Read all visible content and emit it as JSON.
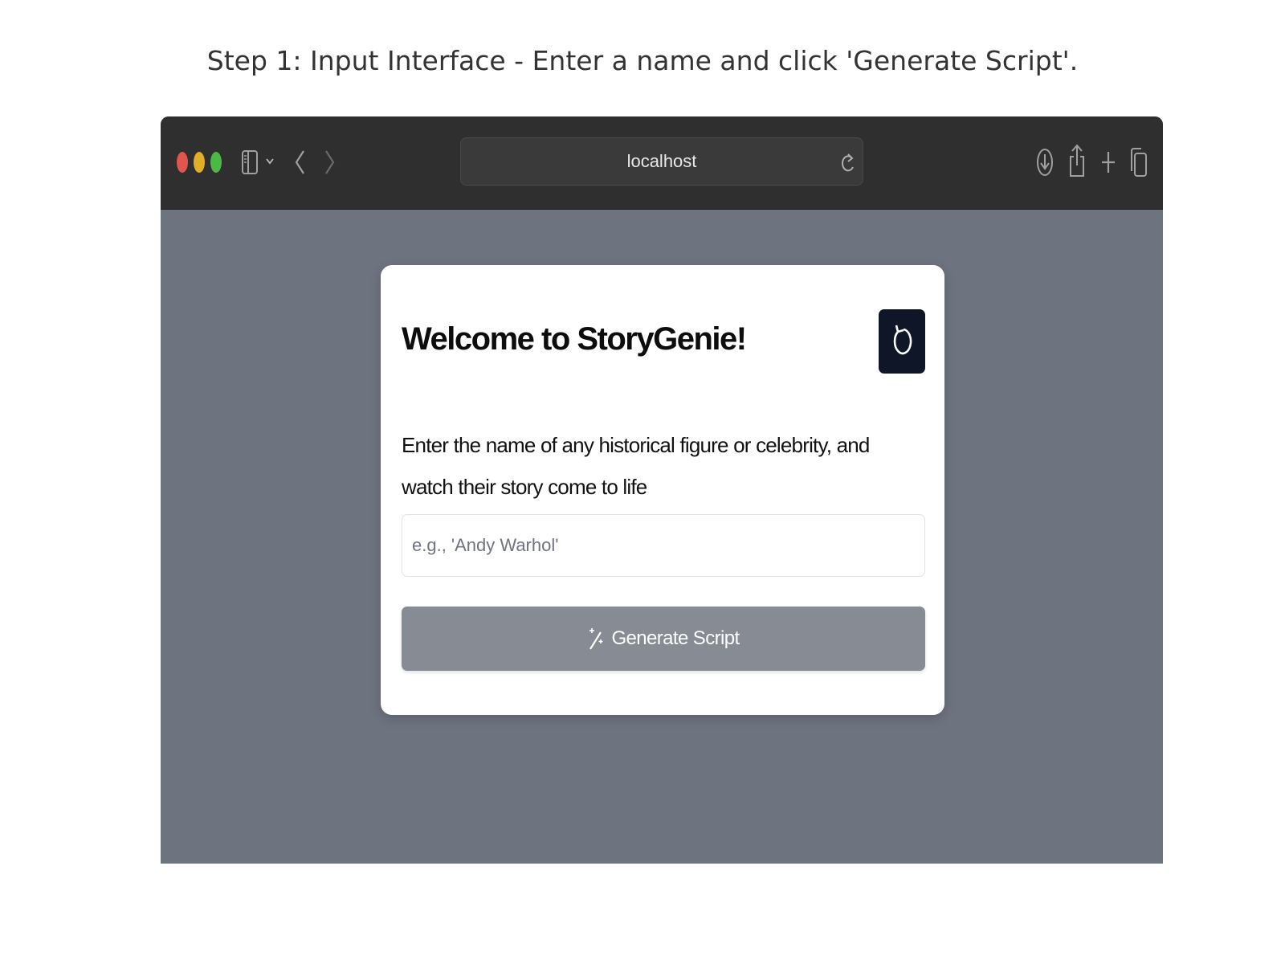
{
  "caption": "Step 1: Input Interface - Enter a name and click 'Generate Script'.",
  "browser": {
    "address": "localhost",
    "icons": [
      "sidebar-icon",
      "chevron-down-icon",
      "back-arrow-icon",
      "forward-arrow-icon",
      "reload-icon",
      "download-icon",
      "share-icon",
      "plus-icon",
      "tabs-icon"
    ],
    "traffic_light_colors": [
      "#e0564f",
      "#e3ad2c",
      "#4cb845"
    ]
  },
  "app": {
    "title": "Welcome to StoryGenie!",
    "description": "Enter the name of any historical figure or celebrity, and watch their story come to life",
    "input": {
      "value": "",
      "placeholder": "e.g., 'Andy Warhol'"
    },
    "generate_button": {
      "label": "Generate Script",
      "icon": "magic-wand-icon"
    },
    "reset_button_icon": "reset-icon"
  },
  "colors": {
    "page_background": "#6e7380",
    "toolbar": "#2f2f2f",
    "reset_button": "#0f1628",
    "generate_button": "#878b93"
  }
}
